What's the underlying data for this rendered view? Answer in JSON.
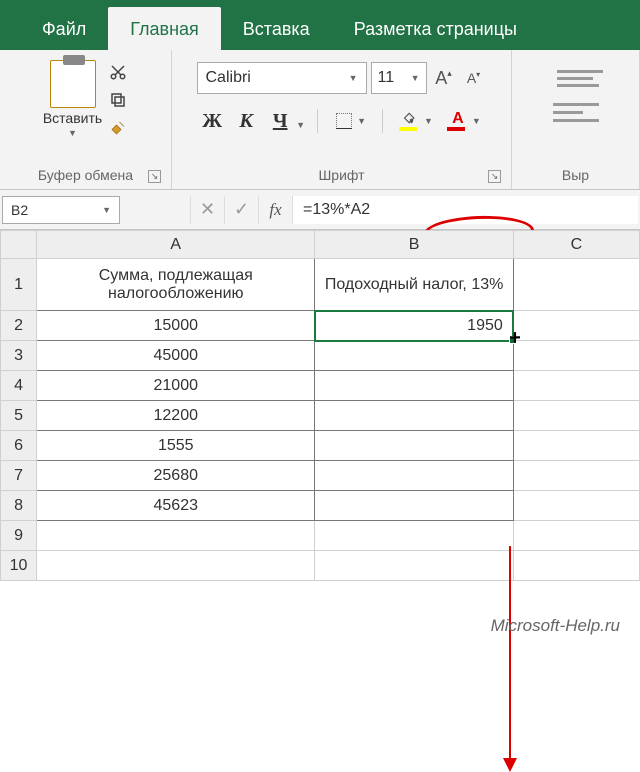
{
  "tabs": {
    "file": "Файл",
    "home": "Главная",
    "insert": "Вставка",
    "pagelayout": "Разметка страницы"
  },
  "ribbon": {
    "clipboard": {
      "label": "Буфер обмена",
      "paste": "Вставить"
    },
    "font": {
      "label": "Шрифт",
      "name": "Calibri",
      "size": "11",
      "bold": "Ж",
      "italic": "К",
      "underline": "Ч",
      "fontcolor_letter": "А"
    },
    "paragraph": {
      "label": "Выр"
    }
  },
  "formula_bar": {
    "name_box": "B2",
    "fx": "fx",
    "formula": "=13%*A2"
  },
  "columns": {
    "A": "A",
    "B": "B",
    "C": "C"
  },
  "rows": [
    "1",
    "2",
    "3",
    "4",
    "5",
    "6",
    "7",
    "8",
    "9",
    "10"
  ],
  "cells": {
    "A1": "Сумма, подлежащая налогообложению",
    "B1": "Подоходный налог, 13%",
    "A2": "15000",
    "B2": "1950",
    "A3": "45000",
    "A4": "21000",
    "A5": "12200",
    "A6": "1555",
    "A7": "25680",
    "A8": "45623"
  },
  "watermark": "Microsoft-Help.ru",
  "chart_data": {
    "type": "table",
    "title": "Подоходный налог, 13%",
    "columns": [
      "Сумма, подлежащая налогообложению",
      "Подоходный налог, 13%"
    ],
    "rows": [
      [
        15000,
        1950
      ],
      [
        45000,
        null
      ],
      [
        21000,
        null
      ],
      [
        12200,
        null
      ],
      [
        1555,
        null
      ],
      [
        25680,
        null
      ],
      [
        45623,
        null
      ]
    ],
    "formula_B2": "=13%*A2"
  }
}
